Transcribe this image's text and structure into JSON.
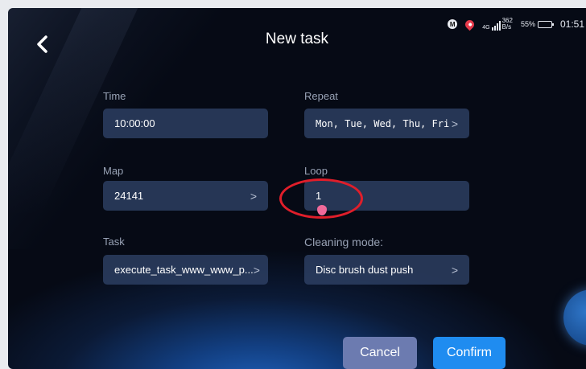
{
  "status_bar": {
    "m_badge": "M",
    "network": "4G",
    "speed_value": "362",
    "speed_unit": "B/s",
    "battery_percent": "55%",
    "battery_level": 0.55,
    "time": "01:51"
  },
  "header": {
    "title": "New task",
    "back_icon": "chevron-left-icon"
  },
  "form": {
    "time": {
      "label": "Time",
      "value": "10:00:00"
    },
    "repeat": {
      "label": "Repeat",
      "value": "Mon, Tue, Wed, Thu, Fri",
      "chevron": ">"
    },
    "map": {
      "label": "Map",
      "value": "24141",
      "chevron": ">"
    },
    "loop": {
      "label": "Loop",
      "value": "1"
    },
    "task": {
      "label": "Task",
      "value": "execute_task_www_www_p...",
      "chevron": ">"
    },
    "cleaning_mode": {
      "label": "Cleaning mode:",
      "value": "Disc brush dust push",
      "chevron": ">"
    }
  },
  "actions": {
    "cancel_label": "Cancel",
    "confirm_label": "Confirm"
  },
  "colors": {
    "accent": "#1f8cf0",
    "cancel": "#6c7bb0",
    "annotation": "#e01e2a"
  }
}
